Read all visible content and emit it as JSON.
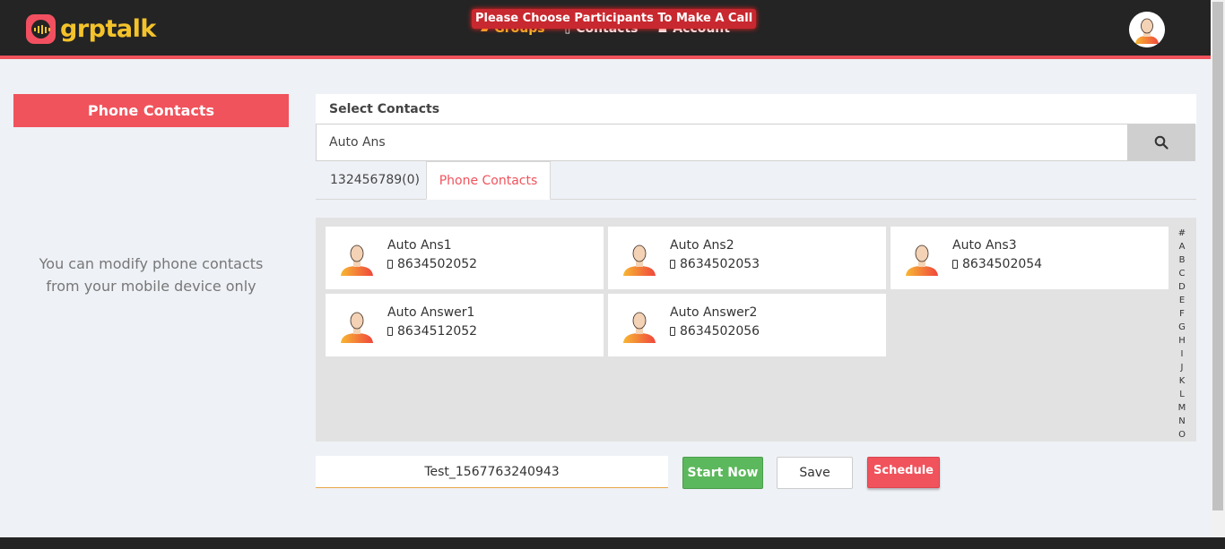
{
  "brand": {
    "name": "grptalk",
    "accent": "#f0535c",
    "logo_color": "#f4c32b"
  },
  "nav": {
    "items": [
      {
        "label": "Groups",
        "icon": "groups-icon",
        "active": true
      },
      {
        "label": "Contacts",
        "icon": "contacts-icon",
        "active": false
      },
      {
        "label": "Account",
        "icon": "account-icon",
        "active": false
      }
    ]
  },
  "toast": {
    "message": "Please Choose Participants To Make A Call"
  },
  "left": {
    "title": "Phone Contacts",
    "note_line1": "You can modify phone contacts",
    "note_line2": "from your mobile device only"
  },
  "select": {
    "header": "Select Contacts",
    "search_value": "Auto Ans"
  },
  "tabs": [
    {
      "label": "132456789(0)",
      "active": false
    },
    {
      "label": "Phone Contacts",
      "active": true
    }
  ],
  "contacts": [
    {
      "name": "Auto Ans1",
      "phone": "8634502052"
    },
    {
      "name": "Auto Ans2",
      "phone": "8634502053"
    },
    {
      "name": "Auto Ans3",
      "phone": "8634502054"
    },
    {
      "name": "Auto Answer1",
      "phone": "8634512052"
    },
    {
      "name": "Auto Answer2",
      "phone": "8634502056"
    }
  ],
  "alphabet": [
    "#",
    "A",
    "B",
    "C",
    "D",
    "E",
    "F",
    "G",
    "H",
    "I",
    "J",
    "K",
    "L",
    "M",
    "N",
    "O"
  ],
  "actions": {
    "group_name_value": "Test_1567763240943",
    "start_label": "Start Now",
    "save_label": "Save",
    "schedule_label": "Schedule"
  }
}
